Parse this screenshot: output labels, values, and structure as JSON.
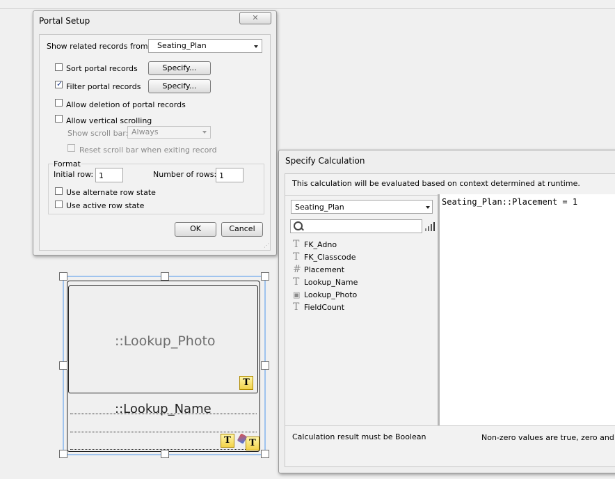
{
  "portal_setup": {
    "title": "Portal Setup",
    "close_label": "✕",
    "show_related_label": "Show related records from:",
    "related_table": "Seating_Plan",
    "sort_label": "Sort portal records",
    "sort_checked": false,
    "filter_label": "Filter portal records",
    "filter_checked": true,
    "specify_label": "Specify...",
    "allow_deletion_label": "Allow deletion of portal records",
    "allow_vertical_label": "Allow vertical scrolling",
    "show_scroll_label": "Show scroll bar:",
    "scroll_value": "Always",
    "reset_scroll_label": "Reset scroll bar when exiting record",
    "format_label": "Format",
    "initial_row_label": "Initial row:",
    "initial_row_value": "1",
    "number_rows_label": "Number of rows:",
    "number_rows_value": "1",
    "alt_row_label": "Use alternate row state",
    "active_row_label": "Use active row state",
    "ok_label": "OK",
    "cancel_label": "Cancel"
  },
  "layout": {
    "photo_field": "::Lookup_Photo",
    "name_field": "::Lookup_Name",
    "text_badge": "T"
  },
  "calc": {
    "title": "Specify Calculation",
    "context_note": "This calculation will be evaluated based on context determined at runtime.",
    "table_select": "Seating_Plan",
    "search_placeholder": "",
    "fields": [
      {
        "icon": "text-field-icon",
        "glyph": "T",
        "name": "FK_Adno"
      },
      {
        "icon": "text-field-icon",
        "glyph": "T",
        "name": "FK_Classcode"
      },
      {
        "icon": "number-field-icon",
        "glyph": "#",
        "name": "Placement"
      },
      {
        "icon": "text-field-icon",
        "glyph": "T",
        "name": "Lookup_Name"
      },
      {
        "icon": "container-field-icon",
        "glyph": "▣",
        "name": "Lookup_Photo"
      },
      {
        "icon": "text-field-icon",
        "glyph": "T",
        "name": "FieldCount"
      }
    ],
    "formula": "Seating_Plan::Placement = 1",
    "result_note": "Calculation result must be Boolean",
    "nonzero_note": "Non-zero values are true, zero and em"
  }
}
